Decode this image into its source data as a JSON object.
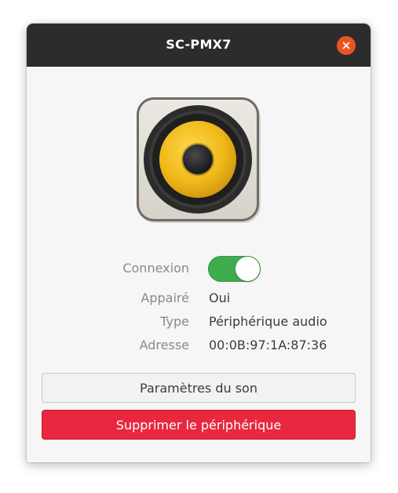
{
  "window": {
    "title": "SC-PMX7"
  },
  "device": {
    "icon": "speaker-icon"
  },
  "properties": {
    "connection_label": "Connexion",
    "connection_on": true,
    "paired_label": "Appairé",
    "paired_value": "Oui",
    "type_label": "Type",
    "type_value": "Périphérique audio",
    "address_label": "Adresse",
    "address_value": "00:0B:97:1A:87:36"
  },
  "actions": {
    "sound_settings_label": "Paramètres du son",
    "remove_label": "Supprimer le périphérique"
  },
  "colors": {
    "titlebar": "#2c2c2c",
    "close_button": "#e95420",
    "toggle_on": "#3fad4f",
    "destructive": "#e9273f"
  }
}
